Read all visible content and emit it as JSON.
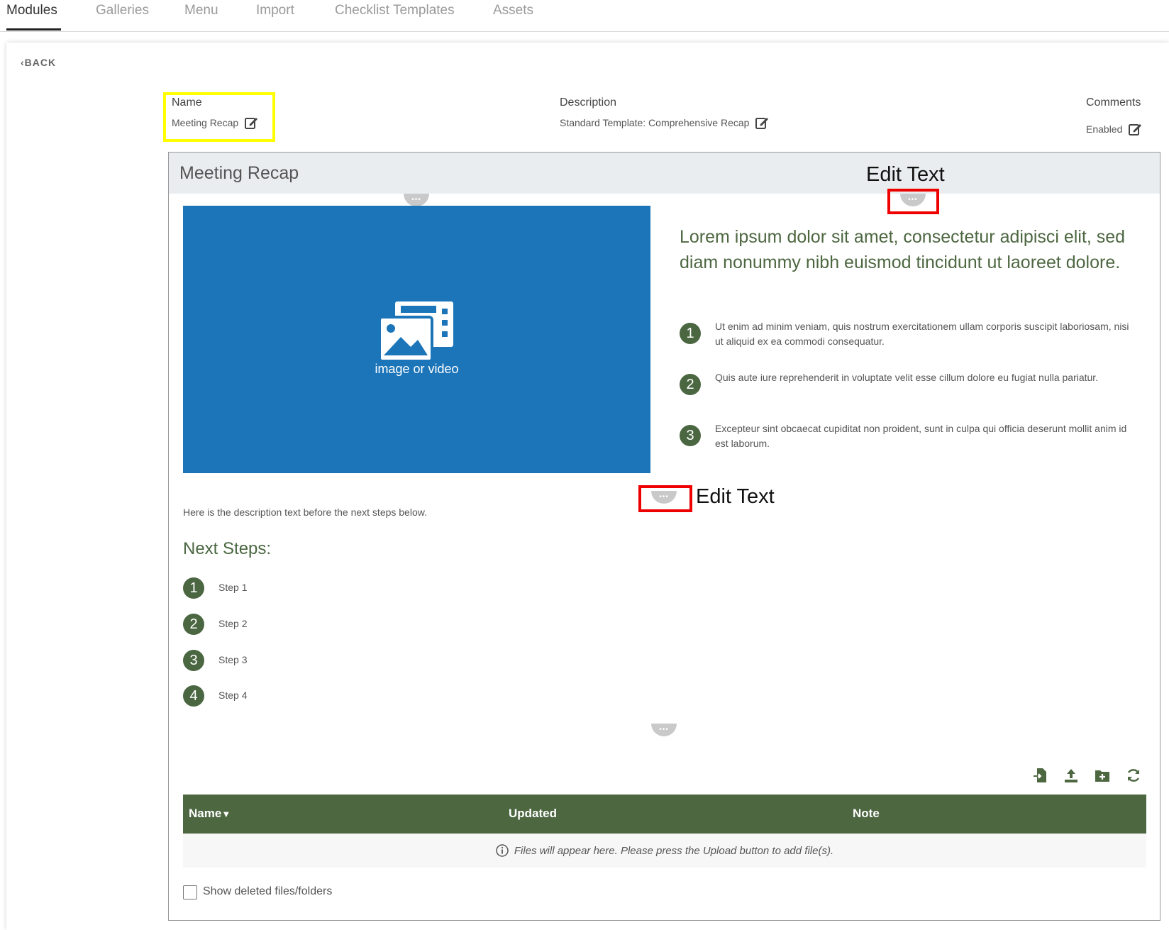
{
  "tabs": [
    {
      "label": "Modules",
      "active": true
    },
    {
      "label": "Galleries",
      "active": false
    },
    {
      "label": "Menu",
      "active": false
    },
    {
      "label": "Import",
      "active": false
    },
    {
      "label": "Checklist Templates",
      "active": false
    },
    {
      "label": "Assets",
      "active": false
    }
  ],
  "back_label": "BACK",
  "meta": {
    "name_label": "Name",
    "name_value": "Meeting Recap",
    "description_label": "Description",
    "description_value": "Standard Template: Comprehensive Recap",
    "comments_label": "Comments",
    "comments_value": "Enabled"
  },
  "card": {
    "title": "Meeting Recap",
    "edit_text_label_1": "Edit Text",
    "edit_text_label_2": "Edit Text",
    "pill_glyph": "•••",
    "media_label": "image or video",
    "lead_text": "Lorem ipsum dolor sit amet, consectetur adipisci elit, sed diam nonummy nibh euismod tincidunt ut laoreet dolore.",
    "bullets": [
      {
        "num": "1",
        "text": "Ut enim ad minim veniam, quis nostrum exercitationem ullam corporis suscipit laboriosam, nisi ut aliquid ex ea commodi consequatur."
      },
      {
        "num": "2",
        "text": "Quis aute iure reprehenderit in voluptate velit esse cillum dolore eu fugiat nulla pariatur."
      },
      {
        "num": "3",
        "text": "Excepteur sint obcaecat cupiditat non proident, sunt in culpa qui officia deserunt mollit anim id est laborum."
      }
    ],
    "description_text": "Here is the description text before the next steps below.",
    "next_steps_title": "Next Steps:",
    "steps": [
      {
        "num": "1",
        "label": "Step 1"
      },
      {
        "num": "2",
        "label": "Step 2"
      },
      {
        "num": "3",
        "label": "Step 3"
      },
      {
        "num": "4",
        "label": "Step 4"
      }
    ]
  },
  "files": {
    "toolbar_icons": [
      "import-file-icon",
      "upload-icon",
      "new-folder-icon",
      "refresh-icon"
    ],
    "columns": [
      "Name",
      "Updated",
      "Note"
    ],
    "sort_indicator": "▼",
    "empty_message": "Files will appear here. Please press the Upload button to add file(s).",
    "show_deleted_label": "Show deleted files/folders",
    "show_deleted_checked": false
  },
  "colors": {
    "accent_green": "#4d6741",
    "media_blue": "#1c75b9",
    "highlight_yellow": "#ffff00",
    "highlight_red": "#ee0000"
  }
}
